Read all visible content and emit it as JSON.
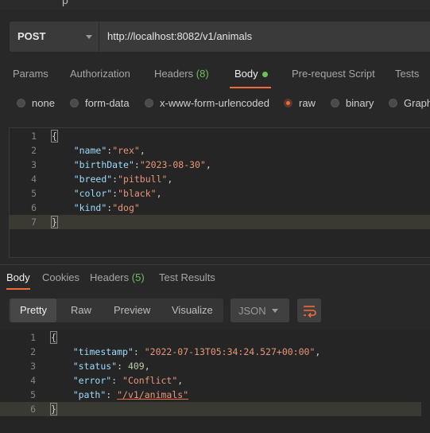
{
  "request": {
    "method": "POST",
    "url": "http://localhost:8082/v1/animals"
  },
  "request_tabs": [
    {
      "label": "Params"
    },
    {
      "label": "Authorization"
    },
    {
      "label": "Headers",
      "count": "(8)"
    },
    {
      "label": "Body"
    },
    {
      "label": "Pre-request Script"
    },
    {
      "label": "Tests"
    }
  ],
  "body_types": [
    "none",
    "form-data",
    "x-www-form-urlencoded",
    "raw",
    "binary",
    "Graph"
  ],
  "selected_body_type": "raw",
  "request_body": {
    "line_numbers": [
      "1",
      "2",
      "3",
      "4",
      "5",
      "6",
      "7"
    ],
    "open_brace": "{",
    "close_brace": "}",
    "fields": [
      {
        "key": "\"name\"",
        "sep": ":",
        "value": "\"rex\"",
        "comma": ","
      },
      {
        "key": "\"birthDate\"",
        "sep": ":",
        "value": "\"2023-08-30\"",
        "comma": ","
      },
      {
        "key": "\"breed\"",
        "sep": ":",
        "value": "\"pitbull\"",
        "comma": ","
      },
      {
        "key": "\"color\"",
        "sep": ":",
        "value": "\"black\"",
        "comma": ","
      },
      {
        "key": "\"kind\"",
        "sep": ":",
        "value": "\"dog\"",
        "comma": ""
      }
    ]
  },
  "response_tabs": [
    {
      "label": "Body"
    },
    {
      "label": "Cookies"
    },
    {
      "label": "Headers",
      "count": "(5)"
    },
    {
      "label": "Test Results"
    }
  ],
  "view_modes": [
    "Pretty",
    "Raw",
    "Preview",
    "Visualize"
  ],
  "format": "JSON",
  "response_body": {
    "line_numbers": [
      "1",
      "2",
      "3",
      "4",
      "5",
      "6"
    ],
    "open_brace": "{",
    "close_brace": "}",
    "fields": [
      {
        "key": "\"timestamp\"",
        "sep": ": ",
        "value": "\"2022-07-13T05:34:24.527+00:00\"",
        "comma": ","
      },
      {
        "key": "\"status\"",
        "sep": ": ",
        "value": "409",
        "comma": ","
      },
      {
        "key": "\"error\"",
        "sep": ": ",
        "value": "\"Conflict\"",
        "comma": ","
      },
      {
        "key": "\"path\"",
        "sep": ": ",
        "value": "\"/v1/animals\"",
        "comma": ""
      }
    ]
  },
  "colors": {
    "accent": "#ef6b3c",
    "count_green": "#6fbf5f",
    "json_key": "#9cdcfe",
    "json_string": "#e8967a",
    "json_number": "#b5cea8"
  }
}
